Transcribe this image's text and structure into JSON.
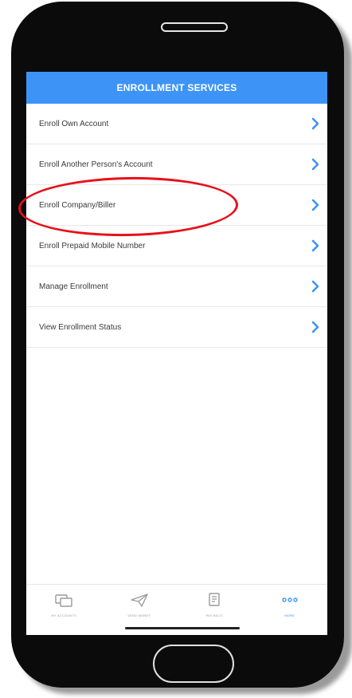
{
  "header": {
    "title": "ENROLLMENT SERVICES"
  },
  "menu": {
    "items": [
      {
        "label": "Enroll Own Account"
      },
      {
        "label": "Enroll Another Person's Account"
      },
      {
        "label": "Enroll Company/Biller"
      },
      {
        "label": "Enroll Prepaid Mobile Number"
      },
      {
        "label": "Manage Enrollment"
      },
      {
        "label": "View Enrollment Status"
      }
    ],
    "highlighted_item": "Enroll Company/Biller"
  },
  "tabbar": {
    "tabs": [
      {
        "label": "MY ACCOUNTS",
        "icon": "accounts-icon"
      },
      {
        "label": "SEND MONEY",
        "icon": "paper-plane-icon"
      },
      {
        "label": "PAY BILLS",
        "icon": "bill-icon"
      },
      {
        "label": "MORE",
        "icon": "more-dots-icon"
      }
    ],
    "active": "MORE"
  },
  "colors": {
    "accent": "#3d94f6",
    "highlight": "#e8101a"
  }
}
